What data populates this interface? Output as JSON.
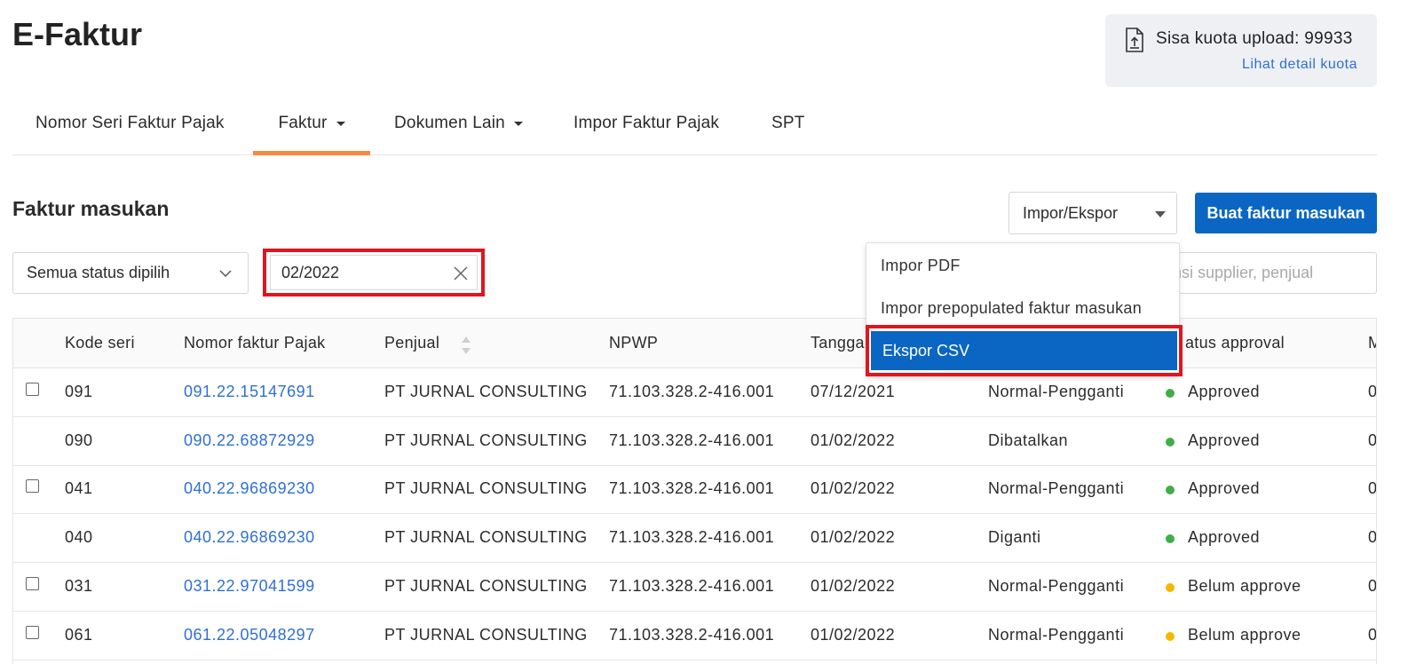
{
  "page": {
    "title": "E-Faktur"
  },
  "quota": {
    "label": "Sisa kuota upload: 99933",
    "link": "Lihat detail kuota"
  },
  "nav": {
    "tabs": [
      {
        "label": "Nomor Seri Faktur Pajak"
      },
      {
        "label": "Faktur"
      },
      {
        "label": "Dokumen Lain"
      },
      {
        "label": "Impor Faktur Pajak"
      },
      {
        "label": "SPT"
      }
    ],
    "active_tab": "Faktur",
    "active_color": "#f58a42"
  },
  "section": {
    "title": "Faktur masukan"
  },
  "toolbar": {
    "impor_ekspor_label": "Impor/Ekspor",
    "create_label": "Buat faktur masukan",
    "create_color": "#0a66c2"
  },
  "filters": {
    "status_value": "Semua status dipilih",
    "date_value": "02/2022",
    "search_placeholder": "nsi supplier, penjual"
  },
  "dropdown": {
    "items": [
      "Impor PDF",
      "Impor prepopulated faktur masukan",
      "Ekspor CSV"
    ],
    "selected": "Ekspor CSV",
    "highlight_color": "#e0151f"
  },
  "table": {
    "headers": [
      "Kode seri",
      "Nomor faktur Pajak",
      "Penjual",
      "NPWP",
      "Tangga",
      "atus approval",
      "M"
    ],
    "rows": [
      {
        "checkbox": true,
        "kode": "091",
        "nomor": "091.22.15147691",
        "penjual": "PT JURNAL CONSULTING",
        "npwp": "71.103.328.2-416.001",
        "tanggal": "07/12/2021",
        "jenis": "Normal-Pengganti",
        "status": "Approved",
        "status_color": "#3fae49",
        "extra": "0"
      },
      {
        "checkbox": false,
        "kode": "090",
        "nomor": "090.22.68872929",
        "penjual": "PT JURNAL CONSULTING",
        "npwp": "71.103.328.2-416.001",
        "tanggal": "01/02/2022",
        "jenis": "Dibatalkan",
        "status": "Approved",
        "status_color": "#3fae49",
        "extra": "0"
      },
      {
        "checkbox": true,
        "kode": "041",
        "nomor": "040.22.96869230",
        "penjual": "PT JURNAL CONSULTING",
        "npwp": "71.103.328.2-416.001",
        "tanggal": "01/02/2022",
        "jenis": "Normal-Pengganti",
        "status": "Approved",
        "status_color": "#3fae49",
        "extra": "0"
      },
      {
        "checkbox": false,
        "kode": "040",
        "nomor": "040.22.96869230",
        "penjual": "PT JURNAL CONSULTING",
        "npwp": "71.103.328.2-416.001",
        "tanggal": "01/02/2022",
        "jenis": "Diganti",
        "status": "Approved",
        "status_color": "#3fae49",
        "extra": "0"
      },
      {
        "checkbox": true,
        "kode": "031",
        "nomor": "031.22.97041599",
        "penjual": "PT JURNAL CONSULTING",
        "npwp": "71.103.328.2-416.001",
        "tanggal": "01/02/2022",
        "jenis": "Normal-Pengganti",
        "status": "Belum approve",
        "status_color": "#f5b800",
        "extra": "0"
      },
      {
        "checkbox": true,
        "kode": "061",
        "nomor": "061.22.05048297",
        "penjual": "PT JURNAL CONSULTING",
        "npwp": "71.103.328.2-416.001",
        "tanggal": "01/02/2022",
        "jenis": "Normal-Pengganti",
        "status": "Belum approve",
        "status_color": "#f5b800",
        "extra": "0"
      }
    ]
  }
}
